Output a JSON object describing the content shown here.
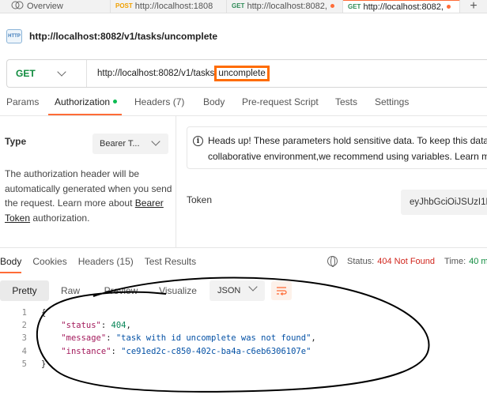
{
  "tabs": [
    {
      "label": "Overview",
      "method": "",
      "active": false
    },
    {
      "label": "http://localhost:1808",
      "method": "POST",
      "active": false,
      "unsaved": true
    },
    {
      "label": "http://localhost:8082,",
      "method": "GET",
      "active": false,
      "unsaved": true
    },
    {
      "label": "http://localhost:8082,",
      "method": "GET",
      "active": true,
      "unsaved": true
    }
  ],
  "request": {
    "badge": "HTTP",
    "title": "http://localhost:8082/v1/tasks/uncomplete",
    "method": "GET",
    "url_prefix": "http://localhost:8082/v1/tasks",
    "url_highlight": "uncomplete"
  },
  "request_tabs": [
    {
      "label": "Params"
    },
    {
      "label": "Authorization",
      "active": true,
      "dot": true
    },
    {
      "label": "Headers (7)"
    },
    {
      "label": "Body"
    },
    {
      "label": "Pre-request Script"
    },
    {
      "label": "Tests"
    },
    {
      "label": "Settings"
    }
  ],
  "auth": {
    "type_label": "Type",
    "type_value": "Bearer T...",
    "desc_1": "The authorization header will be automatically generated when you send the request. Learn more about ",
    "desc_link": "Bearer Token",
    "desc_2": " authorization.",
    "heads_up_line1": "Heads up! These parameters hold sensitive data. To keep this data s",
    "heads_up_line2": "collaborative environment,we recommend using variables. Learn mo",
    "token_label": "Token",
    "token_value": "eyJhbGciOiJSUzI1N"
  },
  "response": {
    "tabs": [
      {
        "label": "Body",
        "active": true
      },
      {
        "label": "Cookies"
      },
      {
        "label": "Headers (15)"
      },
      {
        "label": "Test Results"
      }
    ],
    "status_label": "Status:",
    "status_value": "404 Not Found",
    "time_label": "Time:",
    "time_value": "40 m",
    "formats": [
      "Pretty",
      "Raw",
      "Preview",
      "Visualize"
    ],
    "active_format": "Pretty",
    "language": "JSON",
    "code_lines": [
      "1",
      "2",
      "3",
      "4",
      "5"
    ],
    "body": {
      "open": "{",
      "status_key": "\"status\"",
      "status_val": "404",
      "message_key": "\"message\"",
      "message_val": "\"task with id uncomplete was not found\"",
      "instance_key": "\"instance\"",
      "instance_val": "\"ce91ed2c-c850-402c-ba4a-c6eb6306107e\"",
      "close": "}"
    }
  },
  "colors": {
    "accent": "#ff6c37",
    "highlight_box": "#ff6c00",
    "get_method": "#0f8b3e",
    "status_error": "#d1261d"
  }
}
